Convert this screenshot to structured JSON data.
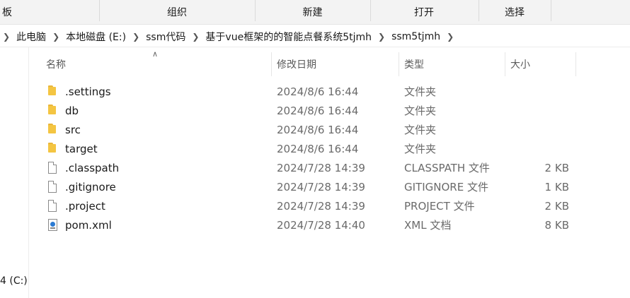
{
  "ribbon": {
    "groups": [
      {
        "label": "板"
      },
      {
        "label": "组织"
      },
      {
        "label": "新建"
      },
      {
        "label": "打开"
      },
      {
        "label": "选择"
      }
    ]
  },
  "breadcrumb": {
    "items": [
      {
        "label": "此电脑"
      },
      {
        "label": "本地磁盘 (E:)"
      },
      {
        "label": "ssm代码"
      },
      {
        "label": "基于vue框架的的智能点餐系统5tjmh"
      },
      {
        "label": "ssm5tjmh"
      }
    ]
  },
  "columns": {
    "name": "名称",
    "date": "修改日期",
    "type": "类型",
    "size": "大小"
  },
  "nav": {
    "drive_label": "4 (C:)"
  },
  "files": [
    {
      "name": ".settings",
      "date": "2024/8/6 16:44",
      "type": "文件夹",
      "size": "",
      "icon": "folder-icon"
    },
    {
      "name": "db",
      "date": "2024/8/6 16:44",
      "type": "文件夹",
      "size": "",
      "icon": "folder-icon"
    },
    {
      "name": "src",
      "date": "2024/8/6 16:44",
      "type": "文件夹",
      "size": "",
      "icon": "folder-icon"
    },
    {
      "name": "target",
      "date": "2024/8/6 16:44",
      "type": "文件夹",
      "size": "",
      "icon": "folder-icon"
    },
    {
      "name": ".classpath",
      "date": "2024/7/28 14:39",
      "type": "CLASSPATH 文件",
      "size": "2 KB",
      "icon": "file-icon"
    },
    {
      "name": ".gitignore",
      "date": "2024/7/28 14:39",
      "type": "GITIGNORE 文件",
      "size": "1 KB",
      "icon": "file-icon"
    },
    {
      "name": ".project",
      "date": "2024/7/28 14:39",
      "type": "PROJECT 文件",
      "size": "2 KB",
      "icon": "file-icon"
    },
    {
      "name": "pom.xml",
      "date": "2024/7/28 14:40",
      "type": "XML 文档",
      "size": "8 KB",
      "icon": "xml-file-icon"
    }
  ],
  "colors": {
    "folder": "#f4c542",
    "secondary_text": "#6a6a6a",
    "ribbon_bg": "#f3f3f3"
  }
}
